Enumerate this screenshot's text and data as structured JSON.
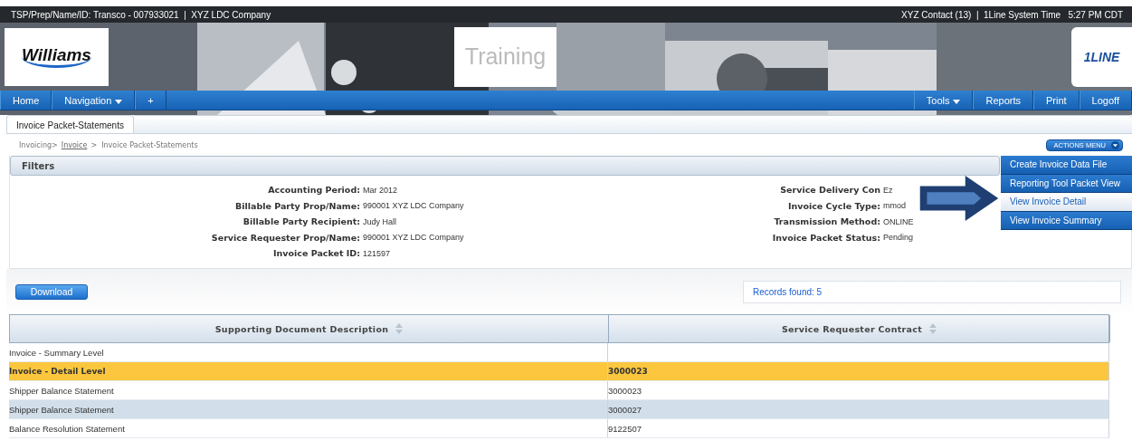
{
  "top_bar": {
    "left": "TSP/Prep/Name/ID: Transco - 007933021  |  XYZ LDC Company",
    "right": "XYZ Contact (13)  |  1Line System Time   5:27 PM CDT"
  },
  "banner": {
    "logo": "Williams",
    "environment": "Training",
    "brand": "1LINE"
  },
  "nav_left": [
    {
      "label": "Home",
      "caret": false
    },
    {
      "label": "Navigation",
      "caret": true
    },
    {
      "label": "+",
      "caret": false
    }
  ],
  "nav_right": [
    {
      "label": "Tools",
      "caret": true
    },
    {
      "label": "Reports",
      "caret": false
    },
    {
      "label": "Print",
      "caret": false
    },
    {
      "label": "Logoff",
      "caret": false
    }
  ],
  "tabs": [
    {
      "label": "Invoice Packet-Statements",
      "selected": true
    }
  ],
  "breadcrumb": [
    {
      "label": "Invoicing>",
      "link": false
    },
    {
      "label": "Invoice",
      "link": true
    },
    {
      "label": ">  Invoice Packet-Statements",
      "link": false
    }
  ],
  "actions_menu": {
    "label": "ACTIONS MENU",
    "items": [
      {
        "label": "Create Invoice Data File",
        "selected": false
      },
      {
        "label": "Reporting Tool Packet View",
        "selected": false
      },
      {
        "label": "View Invoice Detail",
        "selected": true
      },
      {
        "label": "View Invoice Summary",
        "selected": false
      }
    ]
  },
  "filters": {
    "title": "Filters",
    "left": [
      {
        "label": "Accounting Period:",
        "value": "Mar 2012"
      },
      {
        "label": "Billable Party Prop/Name:",
        "value": "990001 XYZ LDC Company"
      },
      {
        "label": "Billable Party Recipient:",
        "value": "Judy Hall"
      },
      {
        "label": "Service Requester Prop/Name:",
        "value": "990001 XYZ LDC Company"
      },
      {
        "label": "Invoice Packet ID:",
        "value": "121597"
      }
    ],
    "right": [
      {
        "label": "Service Delivery Con",
        "value": "Ez"
      },
      {
        "label": "Invoice Cycle Type:",
        "value": "mmod"
      },
      {
        "label": "Transmission Method:",
        "value": "ONLINE"
      },
      {
        "label": "Invoice Packet Status:",
        "value": "Pending"
      }
    ]
  },
  "download_button": "Download",
  "records_found": "Records found: 5",
  "table": {
    "columns": [
      "Supporting Document Description",
      "Service Requester Contract"
    ],
    "rows": [
      {
        "cells": [
          "Invoice - Summary Level",
          ""
        ],
        "selected": false
      },
      {
        "cells": [
          "Invoice - Detail Level",
          "3000023"
        ],
        "selected": true
      },
      {
        "cells": [
          "Shipper Balance Statement",
          "3000023"
        ],
        "selected": false
      },
      {
        "cells": [
          "Shipper Balance Statement",
          "3000027"
        ],
        "selected": false
      },
      {
        "cells": [
          "Balance Resolution Statement",
          "9122507"
        ],
        "selected": false
      }
    ]
  }
}
